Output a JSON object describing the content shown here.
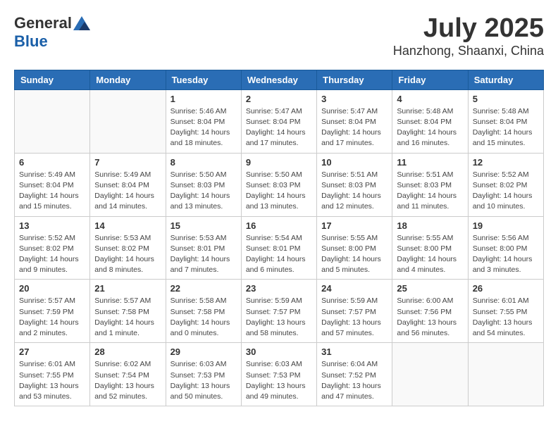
{
  "logo": {
    "general": "General",
    "blue": "Blue"
  },
  "title": {
    "month": "July 2025",
    "location": "Hanzhong, Shaanxi, China"
  },
  "days_of_week": [
    "Sunday",
    "Monday",
    "Tuesday",
    "Wednesday",
    "Thursday",
    "Friday",
    "Saturday"
  ],
  "weeks": [
    [
      {
        "num": "",
        "info": ""
      },
      {
        "num": "",
        "info": ""
      },
      {
        "num": "1",
        "info": "Sunrise: 5:46 AM\nSunset: 8:04 PM\nDaylight: 14 hours and 18 minutes."
      },
      {
        "num": "2",
        "info": "Sunrise: 5:47 AM\nSunset: 8:04 PM\nDaylight: 14 hours and 17 minutes."
      },
      {
        "num": "3",
        "info": "Sunrise: 5:47 AM\nSunset: 8:04 PM\nDaylight: 14 hours and 17 minutes."
      },
      {
        "num": "4",
        "info": "Sunrise: 5:48 AM\nSunset: 8:04 PM\nDaylight: 14 hours and 16 minutes."
      },
      {
        "num": "5",
        "info": "Sunrise: 5:48 AM\nSunset: 8:04 PM\nDaylight: 14 hours and 15 minutes."
      }
    ],
    [
      {
        "num": "6",
        "info": "Sunrise: 5:49 AM\nSunset: 8:04 PM\nDaylight: 14 hours and 15 minutes."
      },
      {
        "num": "7",
        "info": "Sunrise: 5:49 AM\nSunset: 8:04 PM\nDaylight: 14 hours and 14 minutes."
      },
      {
        "num": "8",
        "info": "Sunrise: 5:50 AM\nSunset: 8:03 PM\nDaylight: 14 hours and 13 minutes."
      },
      {
        "num": "9",
        "info": "Sunrise: 5:50 AM\nSunset: 8:03 PM\nDaylight: 14 hours and 13 minutes."
      },
      {
        "num": "10",
        "info": "Sunrise: 5:51 AM\nSunset: 8:03 PM\nDaylight: 14 hours and 12 minutes."
      },
      {
        "num": "11",
        "info": "Sunrise: 5:51 AM\nSunset: 8:03 PM\nDaylight: 14 hours and 11 minutes."
      },
      {
        "num": "12",
        "info": "Sunrise: 5:52 AM\nSunset: 8:02 PM\nDaylight: 14 hours and 10 minutes."
      }
    ],
    [
      {
        "num": "13",
        "info": "Sunrise: 5:52 AM\nSunset: 8:02 PM\nDaylight: 14 hours and 9 minutes."
      },
      {
        "num": "14",
        "info": "Sunrise: 5:53 AM\nSunset: 8:02 PM\nDaylight: 14 hours and 8 minutes."
      },
      {
        "num": "15",
        "info": "Sunrise: 5:53 AM\nSunset: 8:01 PM\nDaylight: 14 hours and 7 minutes."
      },
      {
        "num": "16",
        "info": "Sunrise: 5:54 AM\nSunset: 8:01 PM\nDaylight: 14 hours and 6 minutes."
      },
      {
        "num": "17",
        "info": "Sunrise: 5:55 AM\nSunset: 8:00 PM\nDaylight: 14 hours and 5 minutes."
      },
      {
        "num": "18",
        "info": "Sunrise: 5:55 AM\nSunset: 8:00 PM\nDaylight: 14 hours and 4 minutes."
      },
      {
        "num": "19",
        "info": "Sunrise: 5:56 AM\nSunset: 8:00 PM\nDaylight: 14 hours and 3 minutes."
      }
    ],
    [
      {
        "num": "20",
        "info": "Sunrise: 5:57 AM\nSunset: 7:59 PM\nDaylight: 14 hours and 2 minutes."
      },
      {
        "num": "21",
        "info": "Sunrise: 5:57 AM\nSunset: 7:58 PM\nDaylight: 14 hours and 1 minute."
      },
      {
        "num": "22",
        "info": "Sunrise: 5:58 AM\nSunset: 7:58 PM\nDaylight: 14 hours and 0 minutes."
      },
      {
        "num": "23",
        "info": "Sunrise: 5:59 AM\nSunset: 7:57 PM\nDaylight: 13 hours and 58 minutes."
      },
      {
        "num": "24",
        "info": "Sunrise: 5:59 AM\nSunset: 7:57 PM\nDaylight: 13 hours and 57 minutes."
      },
      {
        "num": "25",
        "info": "Sunrise: 6:00 AM\nSunset: 7:56 PM\nDaylight: 13 hours and 56 minutes."
      },
      {
        "num": "26",
        "info": "Sunrise: 6:01 AM\nSunset: 7:55 PM\nDaylight: 13 hours and 54 minutes."
      }
    ],
    [
      {
        "num": "27",
        "info": "Sunrise: 6:01 AM\nSunset: 7:55 PM\nDaylight: 13 hours and 53 minutes."
      },
      {
        "num": "28",
        "info": "Sunrise: 6:02 AM\nSunset: 7:54 PM\nDaylight: 13 hours and 52 minutes."
      },
      {
        "num": "29",
        "info": "Sunrise: 6:03 AM\nSunset: 7:53 PM\nDaylight: 13 hours and 50 minutes."
      },
      {
        "num": "30",
        "info": "Sunrise: 6:03 AM\nSunset: 7:53 PM\nDaylight: 13 hours and 49 minutes."
      },
      {
        "num": "31",
        "info": "Sunrise: 6:04 AM\nSunset: 7:52 PM\nDaylight: 13 hours and 47 minutes."
      },
      {
        "num": "",
        "info": ""
      },
      {
        "num": "",
        "info": ""
      }
    ]
  ]
}
